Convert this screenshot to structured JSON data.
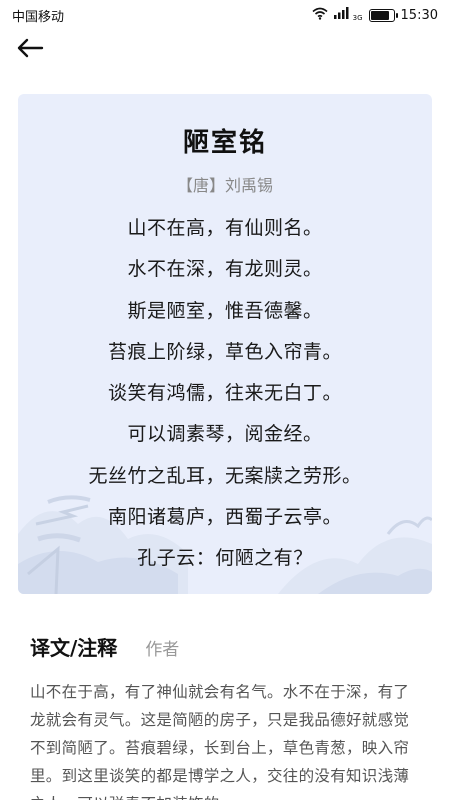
{
  "status_bar": {
    "carrier": "中国移动",
    "network": "3G",
    "battery_level": 0.85,
    "time": "15:30"
  },
  "nav": {
    "back_icon": "arrow-left-icon"
  },
  "poem": {
    "title": "陋室铭",
    "author": "【唐】刘禹锡",
    "lines": [
      "山不在高，有仙则名。",
      "水不在深，有龙则灵。",
      "斯是陋室，惟吾德馨。",
      "苔痕上阶绿，草色入帘青。",
      "谈笑有鸿儒，往来无白丁。",
      "可以调素琴，阅金经。",
      "无丝竹之乱耳，无案牍之劳形。",
      "南阳诸葛庐，西蜀子云亭。",
      "孔子云：何陋之有？"
    ],
    "card_color": "#e9eefb"
  },
  "tabs": [
    {
      "label": "译文/注释",
      "active": true
    },
    {
      "label": "作者",
      "active": false
    }
  ],
  "translation": {
    "text": "山不在于高，有了神仙就会有名气。水不在于深，有了龙就会有灵气。这是简陋的房子，只是我品德好就感觉不到简陋了。苔痕碧绿，长到台上，草色青葱，映入帘里。到这里谈笑的都是博学之人，交往的没有知识浅薄之人，可以弹奏不加装饰的"
  }
}
